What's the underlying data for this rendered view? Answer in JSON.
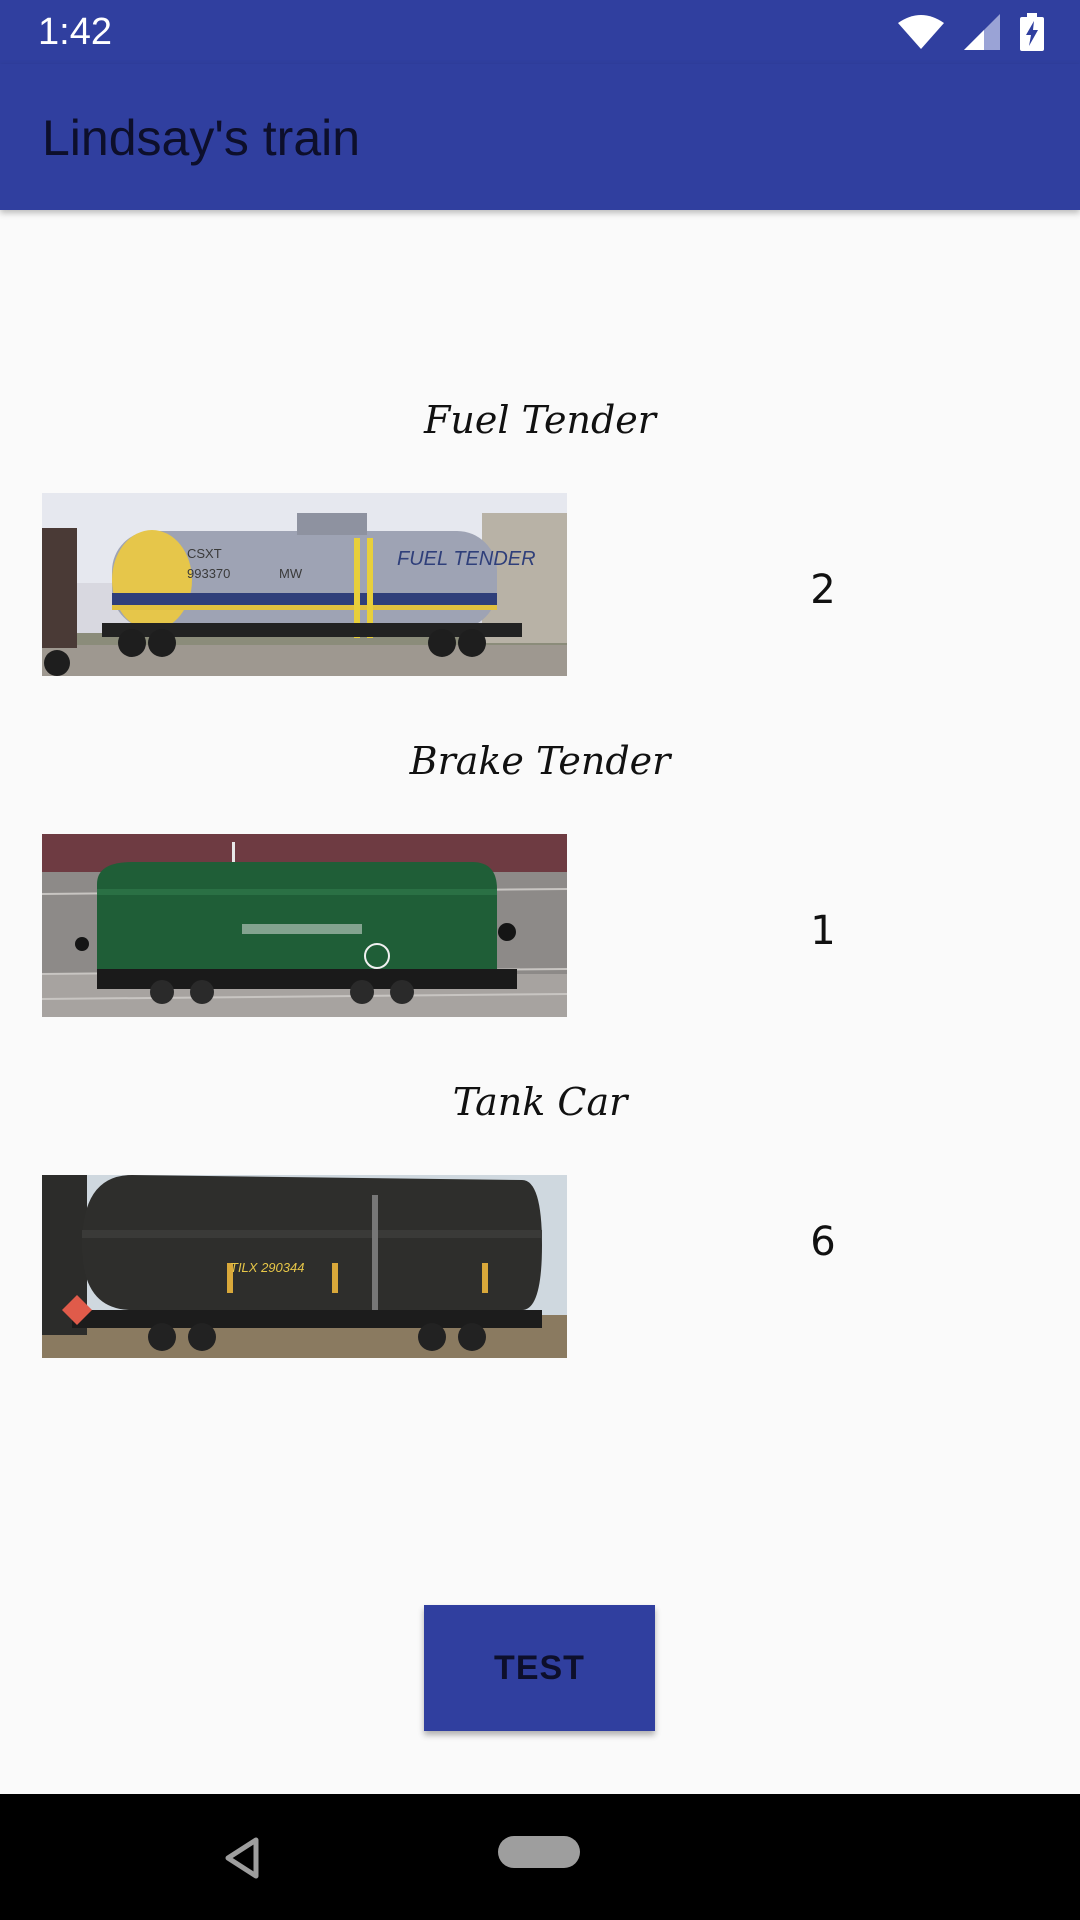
{
  "status_bar": {
    "time": "1:42",
    "icons": [
      "wifi-icon",
      "signal-icon",
      "battery-charging-icon"
    ]
  },
  "app_bar": {
    "title": "Lindsay's train"
  },
  "cars": [
    {
      "name": "Fuel Tender",
      "count": "2",
      "image": "fuel-tender-tank-car-photo"
    },
    {
      "name": "Brake Tender",
      "count": "1",
      "image": "green-brake-tender-model-photo"
    },
    {
      "name": "Tank Car",
      "count": "6",
      "image": "black-tank-car-photo"
    }
  ],
  "test_button": {
    "label": "TEST"
  },
  "nav_bar": {
    "icons": [
      "back-icon",
      "home-pill-icon"
    ]
  },
  "colors": {
    "primary": "#303f9f",
    "background": "#fafafa",
    "nav_background": "#000000"
  }
}
